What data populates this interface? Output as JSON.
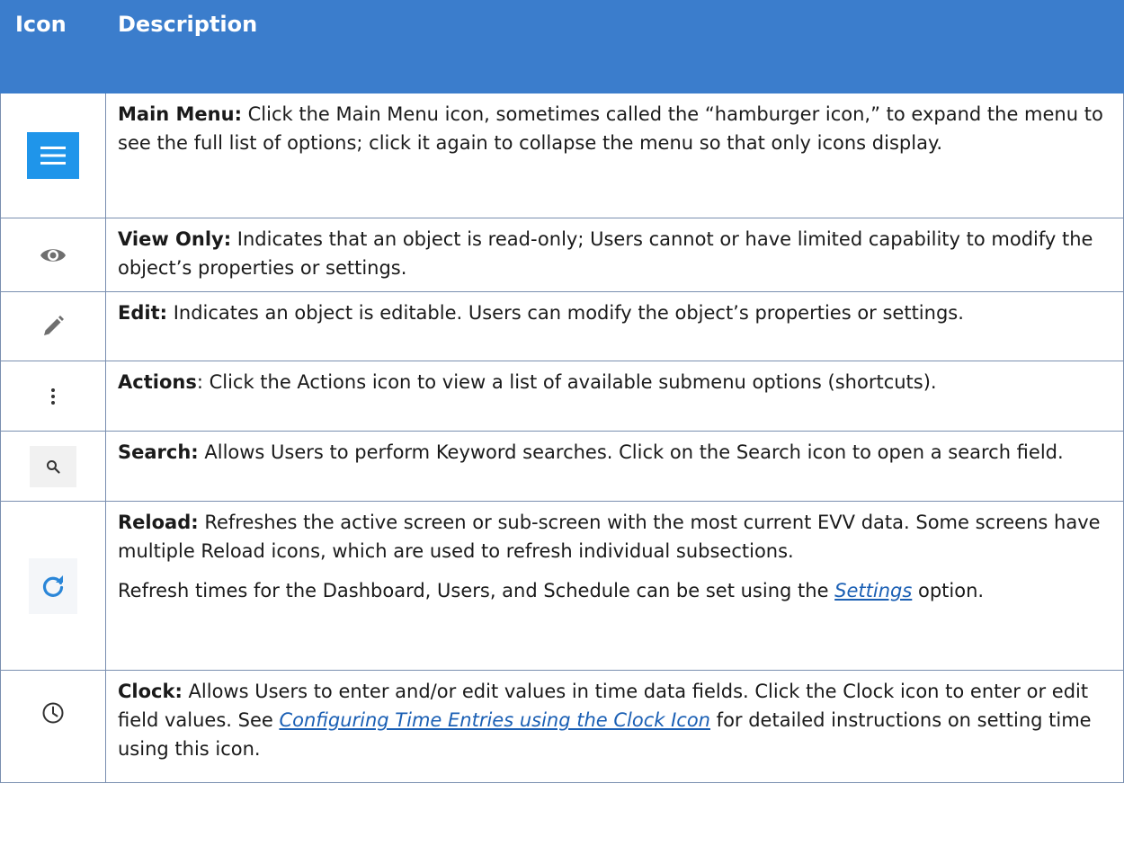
{
  "header": {
    "icon_col": "Icon",
    "description_col": "Description"
  },
  "rows": [
    {
      "icon": "hamburger-menu-icon",
      "term": "Main Menu:",
      "text": " Click the Main Menu icon, sometimes called the “hamburger icon,” to expand the menu to see the full list of options; click it again to collapse the menu so that only icons display."
    },
    {
      "icon": "eye-icon",
      "term": "View Only:",
      "text": " Indicates that an object is read-only; Users cannot or have limited capability to modify the object’s properties or settings."
    },
    {
      "icon": "pencil-icon",
      "term": "Edit:",
      "text": " Indicates an object is editable. Users can modify the object’s properties or settings."
    },
    {
      "icon": "vertical-dots-icon",
      "term": "Actions",
      "text": ": Click the Actions icon to view a list of available submenu options (shortcuts)."
    },
    {
      "icon": "search-icon",
      "term": "Search:",
      "text": " Allows Users to perform Keyword searches. Click on the Search icon to open a search field."
    },
    {
      "icon": "reload-icon",
      "term": "Reload:",
      "text": " Refreshes the active screen or sub-screen with the most current EVV data. Some screens have multiple Reload icons, which are used to refresh individual subsections.",
      "para2_before": "Refresh times for the Dashboard, Users, and Schedule can be set using the ",
      "para2_link": "Settings",
      "para2_after": " option."
    },
    {
      "icon": "clock-icon",
      "term": "Clock:",
      "text": " Allows Users to enter and/or edit values in time data fields. Click the Clock icon to enter or edit field values. See ",
      "link": "Configuring Time Entries using the Clock Icon",
      "text_after": " for detailed instructions on setting time using this icon."
    }
  ],
  "colors": {
    "header_bg": "#3b7dcc",
    "menu_icon_bg": "#1f95ea",
    "reload_icon": "#2a86d8",
    "link": "#1a5fb4"
  }
}
